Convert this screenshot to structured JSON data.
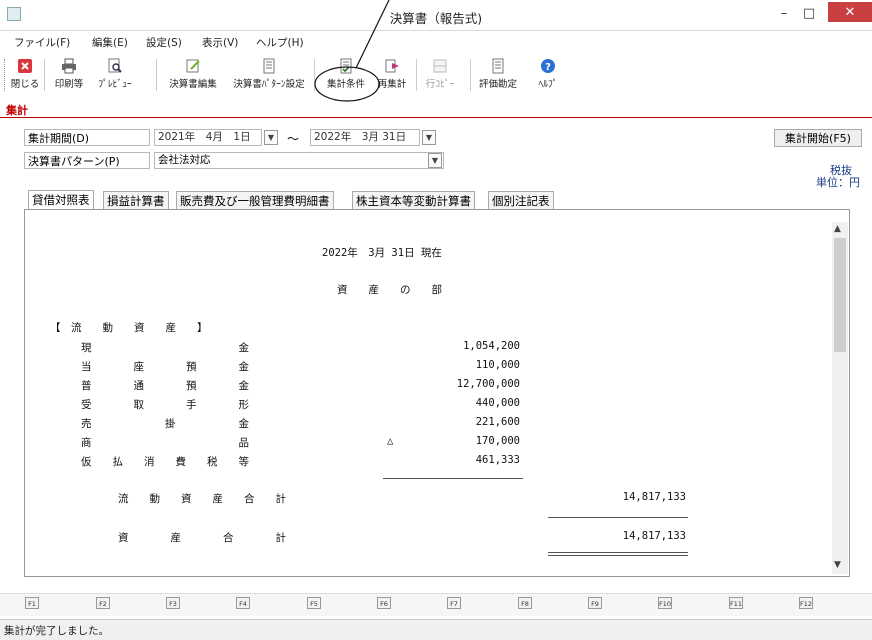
{
  "window": {
    "title": "決算書（報告式)",
    "close_label": "✕",
    "minimize_label": "–",
    "maximize_label": "□"
  },
  "menu": [
    {
      "label": "ファイル(F)"
    },
    {
      "label": "編集(E)"
    },
    {
      "label": "設定(S)"
    },
    {
      "label": "表示(V)"
    },
    {
      "label": "ヘルプ(H)"
    }
  ],
  "toolbar": [
    {
      "label": "閉じる",
      "icon": "close-icon",
      "color": "#d9363e"
    },
    {
      "label": "印刷等",
      "icon": "printer-icon",
      "color": "#555555"
    },
    {
      "label": "ﾌﾟﾚﾋﾞｭｰ",
      "icon": "preview-icon",
      "color": "#555555"
    },
    {
      "label": "決算書編集",
      "icon": "edit-icon",
      "color": "#555555"
    },
    {
      "label": "決算書ﾊﾟﾀｰﾝ設定",
      "icon": "pattern-icon",
      "color": "#555555"
    },
    {
      "label": "集計条件",
      "icon": "condition-icon",
      "color": "#3a7a3a"
    },
    {
      "label": "再集計",
      "icon": "recalc-icon",
      "color": "#c0357a"
    },
    {
      "label": "行ｺﾋﾟｰ",
      "icon": "row-copy-icon",
      "color": "#aaaaaa",
      "disabled": true
    },
    {
      "label": "評価勘定",
      "icon": "valuation-icon",
      "color": "#555555"
    },
    {
      "label": "ﾍﾙﾌﾟ",
      "icon": "help-icon",
      "color": "#2a6fd6"
    }
  ],
  "mode_tab": "集計",
  "form": {
    "period_label": "集計期間(D)",
    "period_from": "2021年　4月　1日",
    "tilde": "～",
    "period_to": "2022年　3月 31日",
    "pattern_label": "決算書パターン(P)",
    "pattern_value": "会社法対応",
    "start_button": "集計開始(F5)",
    "tax_mode": "税抜",
    "unit": "単位：円"
  },
  "report_tabs": [
    {
      "label": "貸借対照表",
      "active": true
    },
    {
      "label": "損益計算書"
    },
    {
      "label": "販売費及び一般管理費明細書"
    },
    {
      "label": "株主資本等変動計算書"
    },
    {
      "label": "個別注記表"
    }
  ],
  "report": {
    "date_line": "2022年　3月 31日 現在",
    "section_title": "資　　産　　の　　部",
    "group_title": "【　流　　動　　資　　産　　】",
    "rows": [
      {
        "name": "現　　　　　　　　　　　　　　金",
        "mark": "",
        "value": "1,054,200"
      },
      {
        "name": "当　　　　座　　　　預　　　　金",
        "mark": "",
        "value": "110,000"
      },
      {
        "name": "普　　　　通　　　　預　　　　金",
        "mark": "",
        "value": "12,700,000"
      },
      {
        "name": "受　　　　取　　　　手　　　　形",
        "mark": "",
        "value": "440,000"
      },
      {
        "name": "売　　　　　　　掛　　　　　　金",
        "mark": "",
        "value": "221,600"
      },
      {
        "name": "商　　　　　　　　　　　　　　品",
        "mark": "△",
        "value": "170,000"
      },
      {
        "name": "仮　　払　　消　　費　　税　　等",
        "mark": "",
        "value": "461,333"
      }
    ],
    "subtotal_label": "流　　動　　資　　産　　合　　計",
    "subtotal_value": "14,817,133",
    "total_label": "資　　　　産　　　　合　　　　計",
    "total_value": "14,817,133"
  },
  "fkeys": [
    "F1",
    "F2",
    "F3",
    "F4",
    "F5",
    "F6",
    "F7",
    "F8",
    "F9",
    "F10",
    "F11",
    "F12"
  ],
  "status": "集計が完了しました。"
}
